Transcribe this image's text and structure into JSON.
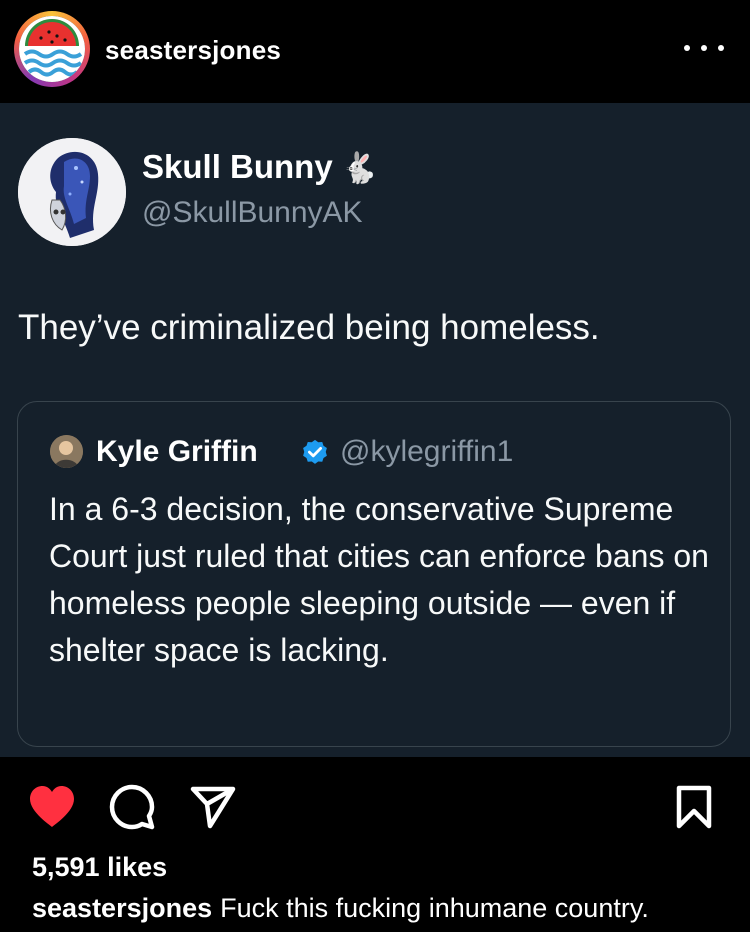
{
  "post": {
    "username": "seastersjones",
    "likes": "5,591 likes",
    "caption_username": "seastersjones",
    "caption_text": "Fuck this fucking inhumane country."
  },
  "tweet": {
    "display_name": "Skull Bunny",
    "name_emoji": "🐇",
    "handle": "@SkullBunnyAK",
    "text": "They’ve criminalized being homeless."
  },
  "quoted_tweet": {
    "display_name": "Kyle Griffin",
    "handle": "@kylegriffin1",
    "text": "In a 6-3 decision, the conservative Supreme Court just ruled that cities can enforce bans on homeless people sleeping outside — even if shelter space is lacking."
  },
  "icons": [
    "watermelon-avatar",
    "more-options-icon",
    "heart-icon",
    "comment-icon",
    "share-icon",
    "bookmark-icon",
    "verified-badge-icon"
  ],
  "colors": {
    "like": "#ff3040",
    "tweet_bg": "#15202b",
    "verified": "#1d9bf0",
    "secondary_text": "#8b98a5"
  }
}
